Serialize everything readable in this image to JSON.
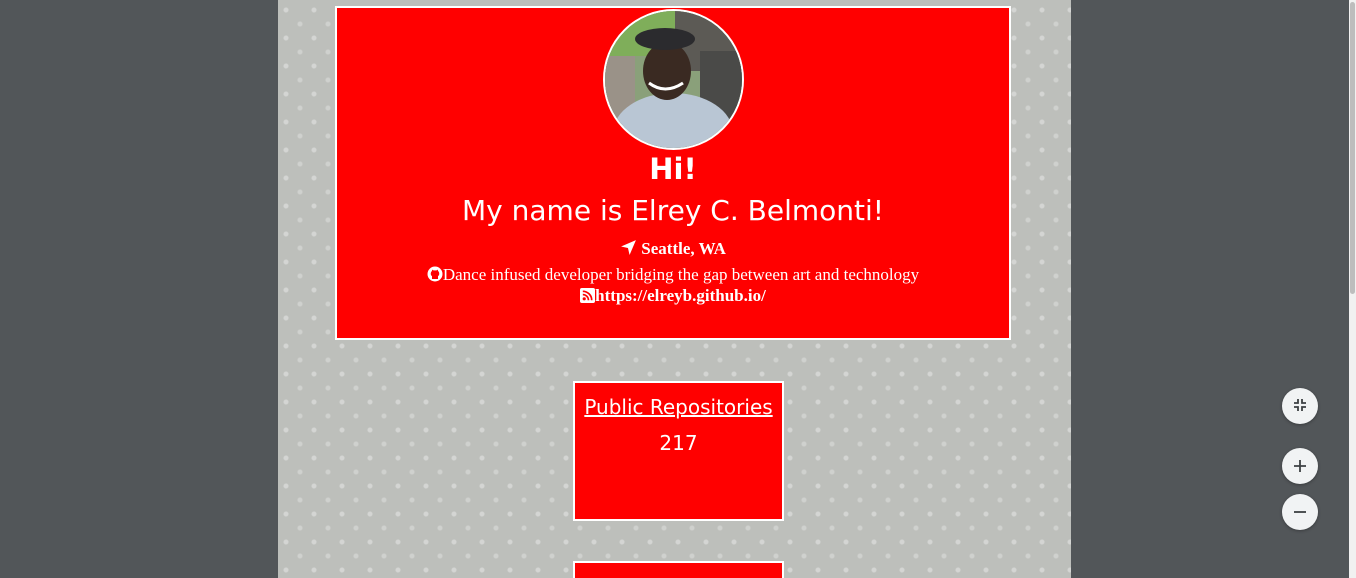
{
  "profile": {
    "greeting": "Hi!",
    "name_line": "My name is Elrey C. Belmonti!",
    "location": "Seattle, WA",
    "bio": "Dance infused developer bridging the gap between art and technology",
    "website": "https://elreyb.github.io/"
  },
  "stats": [
    {
      "label": "Public Repositories",
      "value": "217"
    }
  ],
  "icons": {
    "location": "location-arrow-icon",
    "bio": "github-icon",
    "website": "rss-icon",
    "fit": "fit-to-page-icon",
    "zoom_in": "plus-icon",
    "zoom_out": "minus-icon"
  },
  "colors": {
    "accent": "#ff0000",
    "page_bg": "#bdbfbb",
    "viewer_bg": "#525659"
  }
}
